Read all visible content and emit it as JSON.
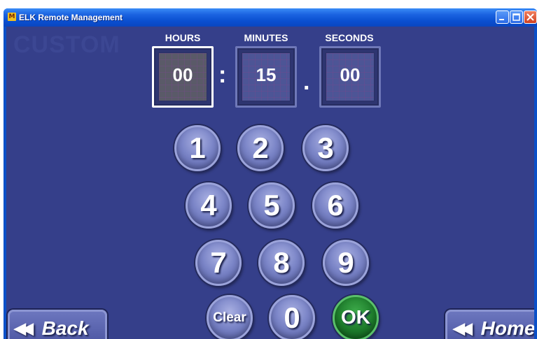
{
  "window": {
    "title": "ELK Remote Management",
    "app_icon_text": "M"
  },
  "screen": {
    "watermark": "CUSTOM"
  },
  "time": {
    "hours_label": "HOURS",
    "minutes_label": "MINUTES",
    "seconds_label": "SECONDS",
    "hours": "00",
    "minutes": "15",
    "seconds": "00",
    "colon": ":",
    "dot": "."
  },
  "keypad": {
    "k1": "1",
    "k2": "2",
    "k3": "3",
    "k4": "4",
    "k5": "5",
    "k6": "6",
    "k7": "7",
    "k8": "8",
    "k9": "9",
    "clear": "Clear",
    "k0": "0",
    "ok": "OK"
  },
  "nav": {
    "back_arrow": "◀◀",
    "back": "Back",
    "home_arrow": "◀◀",
    "home": "Home"
  },
  "colors": {
    "background": "#353f8a",
    "titlebar": "#0a50c8",
    "ok_button": "#1c7a2a",
    "key": "#7c86c8"
  }
}
